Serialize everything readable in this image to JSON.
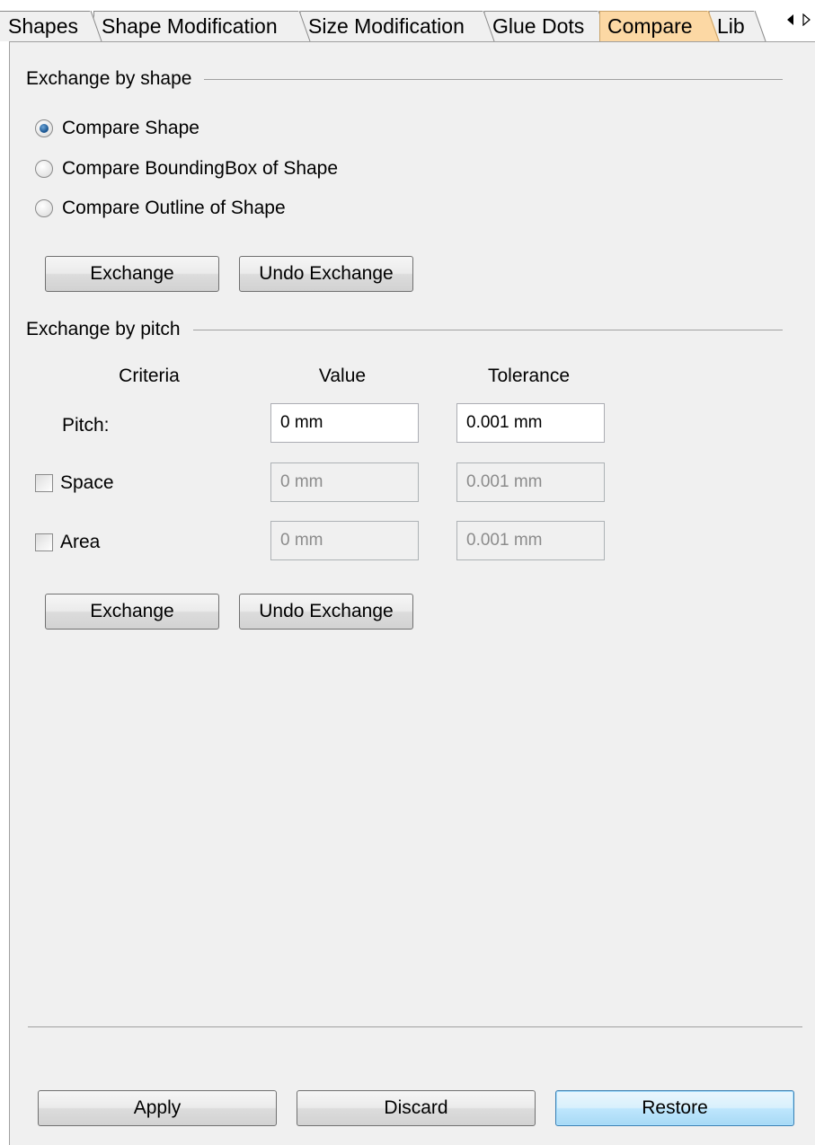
{
  "tabs": [
    {
      "label": "Shapes",
      "active": false
    },
    {
      "label": "Shape Modification",
      "active": false
    },
    {
      "label": "Size Modification",
      "active": false
    },
    {
      "label": "Glue Dots",
      "active": false
    },
    {
      "label": "Compare",
      "active": true
    },
    {
      "label": "Lib",
      "active": false
    }
  ],
  "exchange_by_shape": {
    "title": "Exchange by shape",
    "options": [
      {
        "label": "Compare Shape",
        "checked": true
      },
      {
        "label": "Compare BoundingBox of Shape",
        "checked": false
      },
      {
        "label": "Compare Outline of Shape",
        "checked": false
      }
    ],
    "exchange_label": "Exchange",
    "undo_label": "Undo Exchange"
  },
  "exchange_by_pitch": {
    "title": "Exchange by pitch",
    "headers": {
      "criteria": "Criteria",
      "value": "Value",
      "tolerance": "Tolerance"
    },
    "rows": {
      "pitch": {
        "label": "Pitch:",
        "value": "0 mm",
        "tolerance": "0.001 mm",
        "enabled": true
      },
      "space": {
        "label": "Space",
        "value": "0 mm",
        "tolerance": "0.001 mm",
        "checked": false,
        "enabled": false
      },
      "area": {
        "label": "Area",
        "value": "0 mm",
        "tolerance": "0.001 mm",
        "checked": false,
        "enabled": false
      }
    },
    "exchange_label": "Exchange",
    "undo_label": "Undo Exchange"
  },
  "footer": {
    "apply_label": "Apply",
    "discard_label": "Discard",
    "restore_label": "Restore"
  },
  "icons": {
    "scroll_left": "triangle-left-icon",
    "scroll_right": "triangle-right-icon"
  },
  "colors": {
    "active_tab": "#fcd8a4",
    "panel_bg": "#f0f0f0",
    "default_button": "#bee6fd"
  }
}
